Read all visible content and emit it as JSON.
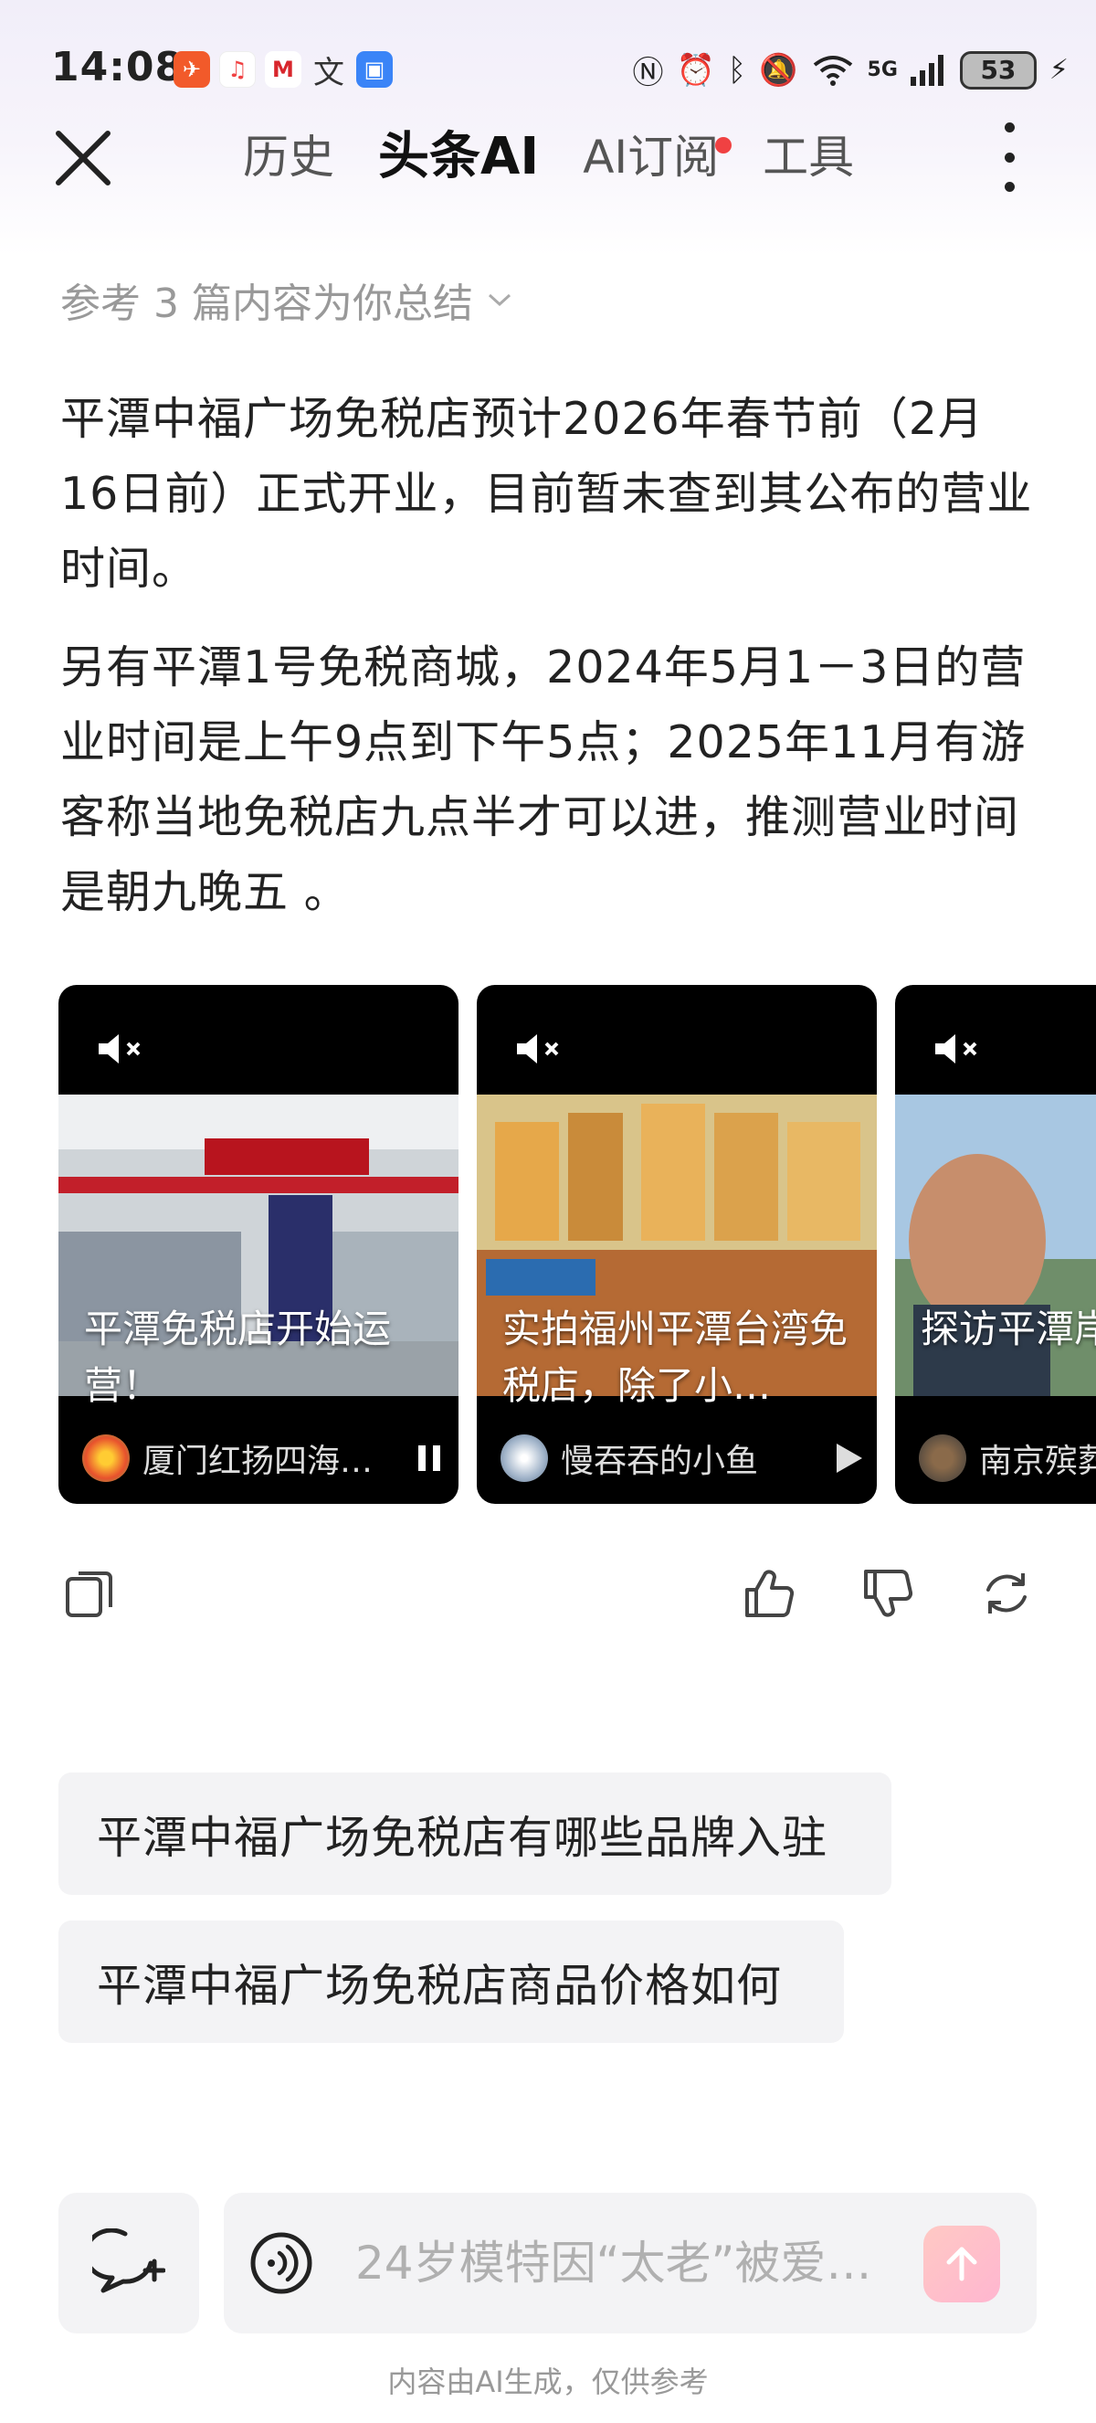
{
  "status_bar": {
    "time": "14:08",
    "battery": "53",
    "network": "5G",
    "app_icons": [
      "toutiao-icon",
      "music-icon",
      "bank-icon",
      "translate-icon",
      "shield-app-icon"
    ],
    "system_icons": [
      "nfc-icon",
      "alarm-icon",
      "bluetooth-icon",
      "mute-icon",
      "wifi-icon",
      "signal-icon",
      "charging-icon"
    ]
  },
  "nav": {
    "tabs": [
      {
        "label": "历史",
        "active": false
      },
      {
        "label": "头条AI",
        "active": true
      },
      {
        "label": "AI订阅",
        "active": false,
        "badge_dot": true
      },
      {
        "label": "工具",
        "active": false
      }
    ]
  },
  "reference": {
    "text": "参考 3 篇内容为你总结"
  },
  "answer": {
    "paragraph1": "平潭中福广场免税店预计2026年春节前（2月16日前）正式开业，目前暂未查到其公布的营业时间。",
    "paragraph2": "另有平潭1号免税商城，2024年5月1－3日的营业时间是上午9点到下午5点；2025年11月有游客称当地免税店九点半才可以进，推测营业时间是朝九晚五 。"
  },
  "videos": [
    {
      "title": "平潭免税店开始运营！",
      "author": "厦门红扬四海…",
      "state": "playing"
    },
    {
      "title": "实拍福州平潭台湾免税店，除了小…",
      "author": "慢吞吞的小鱼",
      "state": "paused"
    },
    {
      "title": "探访平潭岸免税店，",
      "author": "南京殡葬",
      "state": "paused"
    }
  ],
  "suggestions": [
    "平潭中福广场免税店有哪些品牌入驻",
    "平潭中福广场免税店商品价格如何"
  ],
  "input": {
    "placeholder": "24岁模特因“太老”被爱…"
  },
  "disclaimer": "内容由AI生成，仅供参考",
  "colors": {
    "accent_red": "#f04142",
    "chip_bg": "#f3f3f5",
    "send_gradient": "#ffc9c4"
  }
}
